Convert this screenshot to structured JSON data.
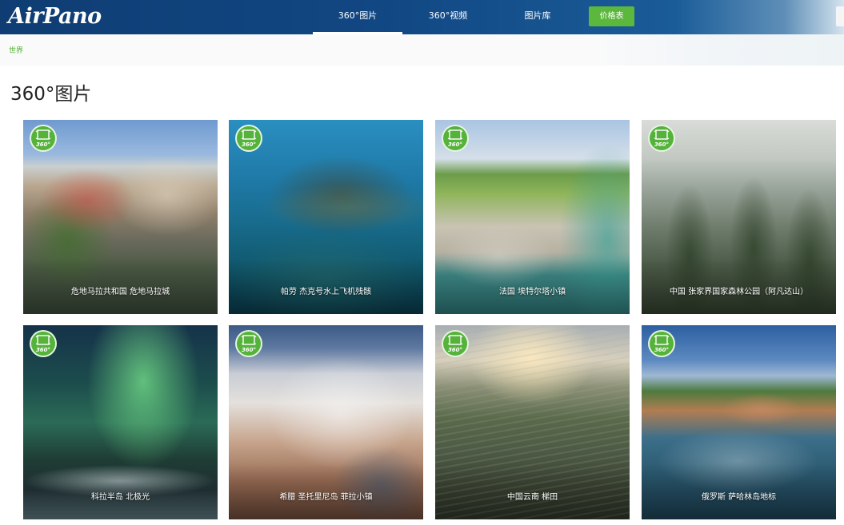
{
  "header": {
    "logo": "AirPano",
    "nav": [
      {
        "label": "360°图片",
        "active": true
      },
      {
        "label": "360°视频",
        "active": false
      },
      {
        "label": "图片库",
        "active": false
      }
    ],
    "price_button": "价格表"
  },
  "breadcrumb": "世界",
  "page_title": "360°图片",
  "badge_text": "360°",
  "cards": [
    {
      "caption": "危地马拉共和国 危地马拉城"
    },
    {
      "caption": "帕劳 杰克号水上飞机残骸"
    },
    {
      "caption": "法国 埃特尔塔小镇"
    },
    {
      "caption": "中国 张家界国家森林公园（阿凡达山）"
    },
    {
      "caption": "科拉半岛 北极光"
    },
    {
      "caption": "希腊 圣托里尼岛 菲拉小镇"
    },
    {
      "caption": "中国云南 梯田"
    },
    {
      "caption": "俄罗斯 萨哈林岛地标"
    }
  ],
  "colors": {
    "header_bg": "#114783",
    "accent_green": "#5cb83d",
    "breadcrumb_green": "#4fae33"
  }
}
